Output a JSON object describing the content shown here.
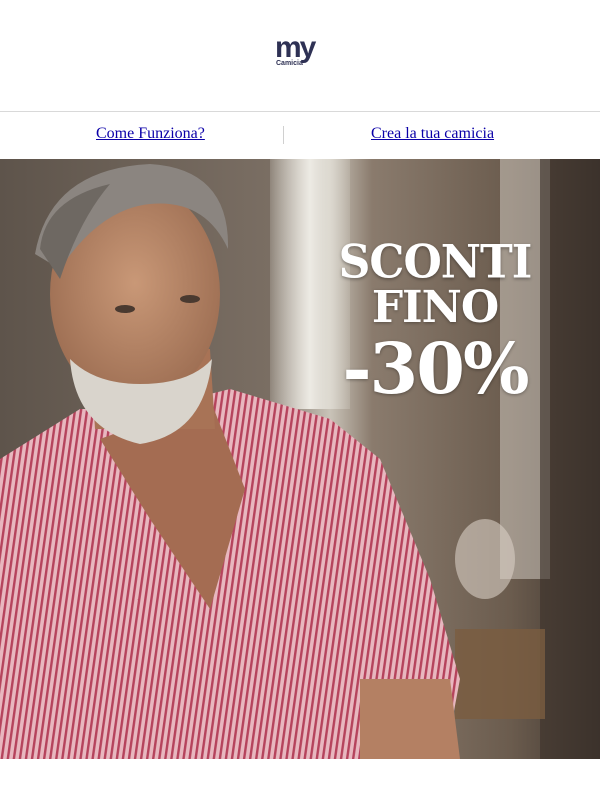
{
  "brand": {
    "logo_main": "my",
    "logo_sub": "Camicia",
    "color": "#2e3154"
  },
  "nav": {
    "items": [
      {
        "label": "Come Funziona?"
      },
      {
        "label": "Crea la tua camicia"
      }
    ],
    "link_color": "#0b00a8"
  },
  "hero": {
    "headline_line1": "SCONTI",
    "headline_line2": "FINO",
    "headline_line3": "-30%",
    "text_color": "#ffffff",
    "shirt_color": "#c97a8a"
  }
}
